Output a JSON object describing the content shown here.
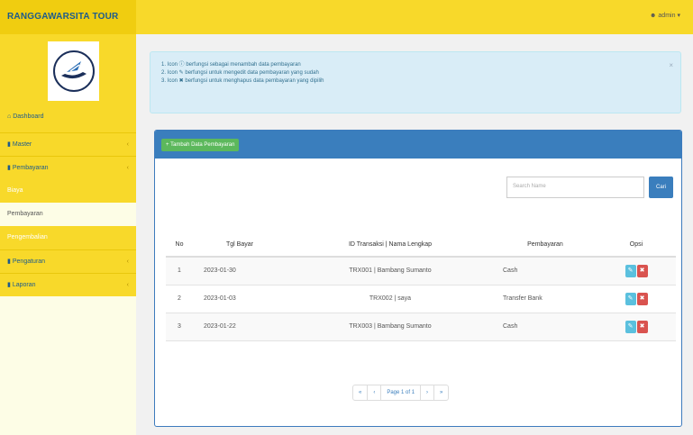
{
  "app": {
    "brand": "RANGGAWARSITA TOUR",
    "user_label": "admin",
    "user_icon": "person-icon"
  },
  "sidebar": {
    "dashboard": "Dashboard",
    "items": [
      {
        "label": "Master",
        "icon": "file-icon"
      },
      {
        "label": "Pembayaran",
        "icon": "file-icon"
      }
    ],
    "subitems": [
      {
        "label": "Biaya",
        "active": false
      },
      {
        "label": "Pembayaran",
        "active": true
      },
      {
        "label": "Pengembalian",
        "active": false
      }
    ],
    "items_after": [
      {
        "label": "Pengaturan",
        "icon": "file-icon"
      },
      {
        "label": "Laporan",
        "icon": "file-icon"
      }
    ]
  },
  "alert": {
    "lines": [
      "1. Icon ⓘ berfungsi sebagai menambah data pembayaran",
      "2. Icon ✎ berfungsi untuk mengedit data pembayaran yang sudah",
      "3. Icon ✖ berfungsi untuk menghapus data pembayaran yang dipilih"
    ],
    "close": "×"
  },
  "toolbar": {
    "add_label": "+ Tambah Data Pembayaran"
  },
  "search": {
    "placeholder": "Search Name",
    "button": "Cari"
  },
  "table": {
    "headers": [
      "No",
      "Tgl Bayar",
      "ID Transaksi | Nama Lengkap",
      "Pembayaran",
      "Opsi"
    ],
    "rows": [
      {
        "no": "1",
        "tgl": "2023-01-30",
        "id_nama": "TRX001 | Bambang Sumanto",
        "pembayaran": "Cash"
      },
      {
        "no": "2",
        "tgl": "2023-01-03",
        "id_nama": "TRX002 | saya",
        "pembayaran": "Transfer Bank"
      },
      {
        "no": "3",
        "tgl": "2023-01-22",
        "id_nama": "TRX003 | Bambang Sumanto",
        "pembayaran": "Cash"
      }
    ],
    "edit_icon": "✎",
    "delete_icon": "✖"
  },
  "pagination": {
    "first": "«",
    "prev": "‹",
    "page": "Page 1 of 1",
    "next": "›",
    "last": "»"
  },
  "colors": {
    "topbar": "#f8d92a",
    "panel_header": "#3a7ebd",
    "add_button": "#5cb85c",
    "edit": "#5bc0de",
    "delete": "#d9534f",
    "brand_text": "#1d5b8c"
  }
}
